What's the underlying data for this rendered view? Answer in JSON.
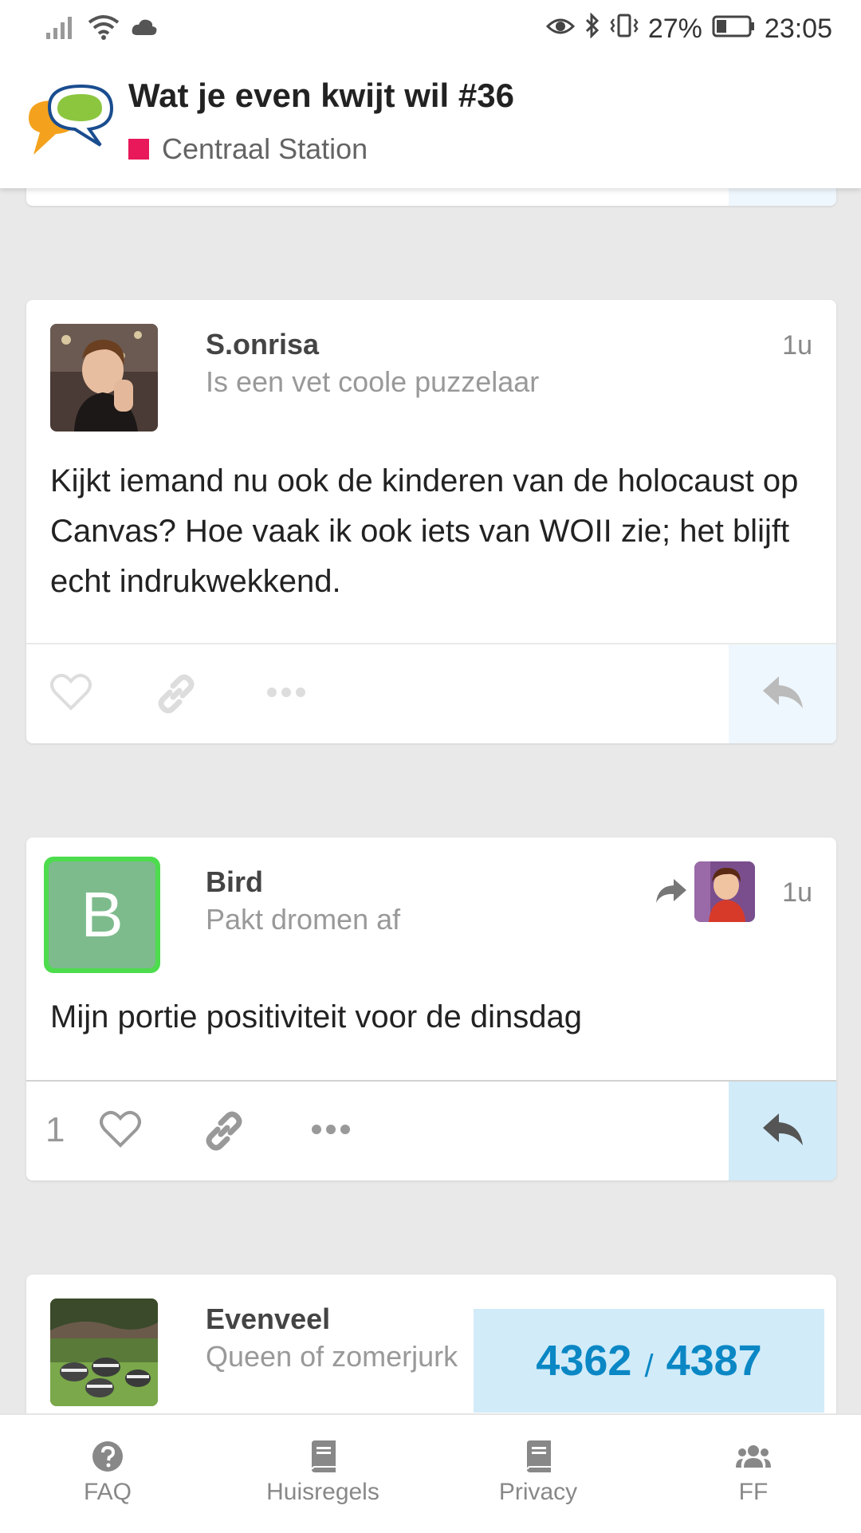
{
  "status_bar": {
    "battery_percent": "27%",
    "time": "23:05"
  },
  "header": {
    "topic_title": "Wat je even kwijt wil #36",
    "category": "Centraal Station",
    "category_color": "#e8185a"
  },
  "posts": [
    {
      "username": "S.onrisa",
      "user_title": "Is een vet coole puzzelaar",
      "time": "1u",
      "body": "Kijkt iemand nu ook de kinderen van de holocaust op Canvas? Hoe vaak ik ook iets van WOII zie; het blijft echt indrukwekkend."
    },
    {
      "username": "Bird",
      "user_title": "Pakt dromen af",
      "time": "1u",
      "avatar_letter": "B",
      "body": "Mijn portie positiviteit voor de dinsdag",
      "like_count": "1"
    },
    {
      "username": "Evenveel",
      "user_title": "Queen of zomerjurk"
    }
  ],
  "progress": {
    "current": "4362",
    "separator": "/",
    "total": "4387"
  },
  "bottom_nav": {
    "faq": "FAQ",
    "huisregels": "Huisregels",
    "privacy": "Privacy",
    "ff": "FF"
  },
  "colors": {
    "accent": "#0a87c4",
    "reply_active_bg": "#d1ebf9",
    "avatar_green": "#7dbb8c"
  }
}
